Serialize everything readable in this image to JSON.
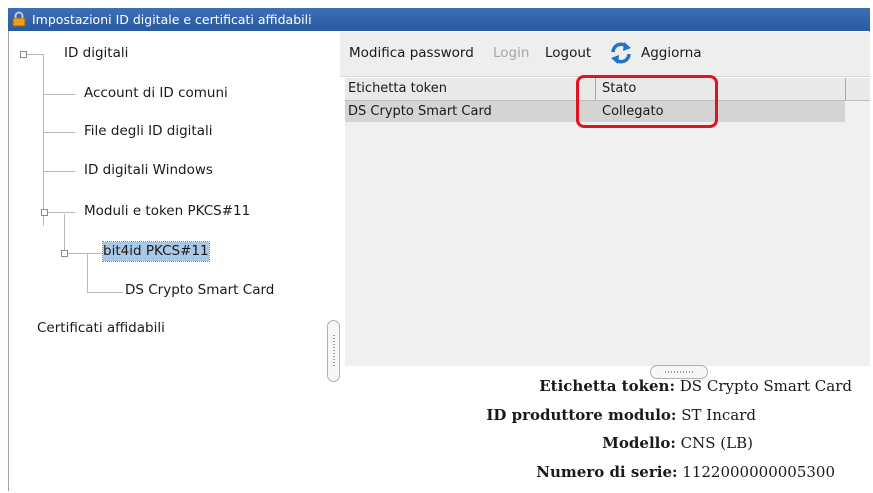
{
  "window": {
    "title": "Impostazioni ID digitale e certificati affidabili"
  },
  "tree": {
    "digital_ids": "ID digitali",
    "roaming_accounts": "Account di ID comuni",
    "id_files": "File degli ID digitali",
    "windows_ids": "ID digitali Windows",
    "pkcs_modules": "Moduli e token PKCS#11",
    "bit4id": "bit4id PKCS#11",
    "ds_card": "DS Crypto Smart Card",
    "trusted_certs": "Certificati affidabili"
  },
  "toolbar": {
    "change_password": "Modifica password",
    "login": "Login",
    "logout": "Logout",
    "refresh": "Aggiorna"
  },
  "table": {
    "columns": [
      "Etichetta token",
      "Stato"
    ],
    "rows": [
      {
        "label": "DS Crypto Smart Card",
        "status": "Collegato"
      }
    ]
  },
  "details": {
    "token_label_k": "Etichetta token:",
    "token_label_v": " DS Crypto Smart Card",
    "manufacturer_k": "ID produttore modulo:",
    "manufacturer_v": " ST Incard",
    "model_k": "Modello:",
    "model_v": " CNS (LB)",
    "serial_k": "Numero di serie:",
    "serial_v": " 1122000000005300"
  },
  "colors": {
    "titlebar": "#2f62aa",
    "selection": "#a9c8e8",
    "annotation": "#e0141e",
    "row_bg": "#d4d4d4"
  }
}
